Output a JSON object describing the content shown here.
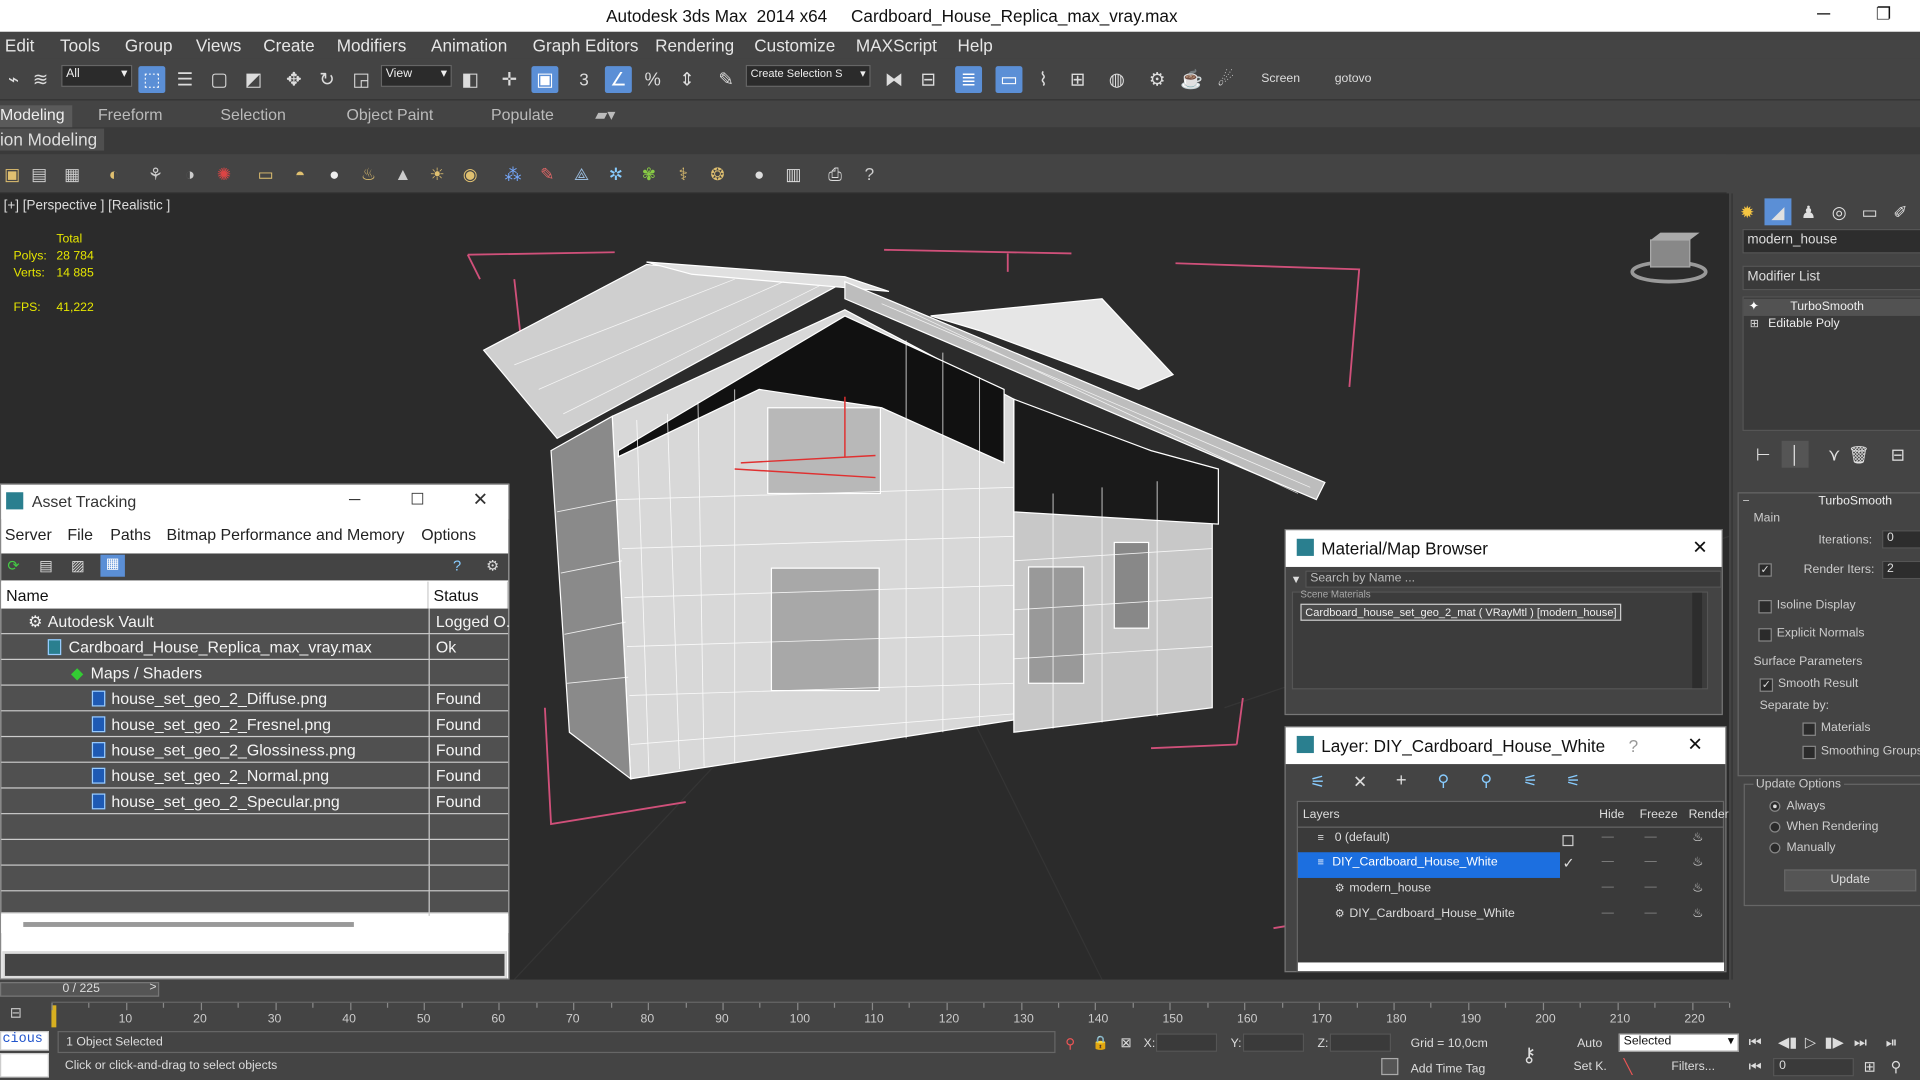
{
  "window": {
    "title": "Autodesk 3ds Max  2014 x64     Cardboard_House_Replica_max_vray.max"
  },
  "menu": [
    "Edit",
    "Tools",
    "Group",
    "Views",
    "Create",
    "Modifiers",
    "Animation",
    "Graph Editors",
    "Rendering",
    "Customize",
    "MAXScript",
    "Help"
  ],
  "toolbar": {
    "filter_value": "All",
    "ref_coord_value": "View",
    "snap_label": "3",
    "selection_set_placeholder": "Create Selection S",
    "screen_label": "Screen",
    "gotovo_label": "gotovo"
  },
  "ribbon": {
    "tabs": [
      "Modeling",
      "Freeform",
      "Selection",
      "Object Paint",
      "Populate"
    ],
    "subtitle": "ion Modeling"
  },
  "viewport": {
    "label": "[+] [Perspective ] [Realistic ]",
    "stats_total_label": "Total",
    "polys_label": "Polys:",
    "polys_value": "28 784",
    "verts_label": "Verts:",
    "verts_value": "14 885",
    "fps_label": "FPS:",
    "fps_value": "41,222"
  },
  "asset_tracking": {
    "title": "Asset Tracking",
    "menu": [
      "Server",
      "File",
      "Paths",
      "Bitmap Performance and Memory",
      "Options"
    ],
    "columns": [
      "Name",
      "Status"
    ],
    "rows": [
      {
        "name": "Autodesk Vault",
        "status": "Logged O."
      },
      {
        "name": "Cardboard_House_Replica_max_vray.max",
        "status": "Ok"
      },
      {
        "name": "Maps / Shaders",
        "status": ""
      },
      {
        "name": "house_set_geo_2_Diffuse.png",
        "status": "Found"
      },
      {
        "name": "house_set_geo_2_Fresnel.png",
        "status": "Found"
      },
      {
        "name": "house_set_geo_2_Glossiness.png",
        "status": "Found"
      },
      {
        "name": "house_set_geo_2_Normal.png",
        "status": "Found"
      },
      {
        "name": "house_set_geo_2_Specular.png",
        "status": "Found"
      }
    ]
  },
  "material_browser": {
    "title": "Material/Map Browser",
    "search_placeholder": "Search by Name ...",
    "group_label": "Scene Materials",
    "item": "Cardboard_house_set_geo_2_mat ( VRayMtl ) [modern_house]"
  },
  "layer_dialog": {
    "title": "Layer: DIY_Cardboard_House_White",
    "help": "?",
    "columns": [
      "Layers",
      "Hide",
      "Freeze",
      "Render"
    ],
    "rows": [
      {
        "name": "0 (default)",
        "selected": false
      },
      {
        "name": "DIY_Cardboard_House_White",
        "selected": true
      },
      {
        "name": "modern_house",
        "selected": false
      },
      {
        "name": "DIY_Cardboard_House_White",
        "selected": false
      }
    ]
  },
  "command_panel": {
    "object_name": "modern_house",
    "modifier_list_label": "Modifier List",
    "stack": [
      "TurboSmooth",
      "Editable Poly"
    ],
    "rollout_title": "TurboSmooth",
    "main_label": "Main",
    "iterations_label": "Iterations:",
    "iterations_value": "0",
    "render_iters_label": "Render Iters:",
    "render_iters_value": "2",
    "isoline_label": "Isoline Display",
    "explicit_label": "Explicit Normals",
    "surface_label": "Surface Parameters",
    "smooth_result_label": "Smooth Result",
    "separate_by_label": "Separate by:",
    "materials_label": "Materials",
    "smoothing_groups_label": "Smoothing Groups",
    "update_options_label": "Update Options",
    "always_label": "Always",
    "when_rendering_label": "When Rendering",
    "manually_label": "Manually",
    "update_button": "Update"
  },
  "timeline": {
    "frame_counter": "0 / 225",
    "ticks": [
      "10",
      "20",
      "30",
      "40",
      "50",
      "60",
      "70",
      "80",
      "90",
      "100",
      "110",
      "120",
      "130",
      "140",
      "150",
      "160",
      "170",
      "180",
      "190",
      "200",
      "210",
      "220"
    ]
  },
  "status": {
    "selected_text": "1 Object Selected",
    "prompt_text": "Click or click-and-drag to select objects",
    "x_label": "X:",
    "y_label": "Y:",
    "z_label": "Z:",
    "grid_text": "Grid = 10,0cm",
    "auto_label": "Auto",
    "setk_label": "Set K.",
    "selected_dropdown": "Selected",
    "filters_label": "Filters...",
    "add_time_tag": "Add Time Tag",
    "frame_value": "0",
    "script_listener": "cious"
  }
}
